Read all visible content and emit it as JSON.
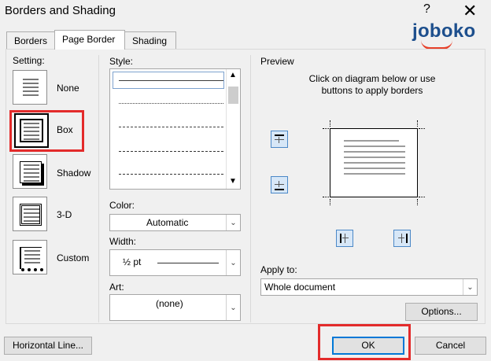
{
  "window": {
    "title": "Borders and Shading",
    "help_icon": "question-mark",
    "close_icon": "close"
  },
  "tabs": [
    {
      "label": "Borders",
      "active": false
    },
    {
      "label": "Page Border",
      "active": true
    },
    {
      "label": "Shading",
      "active": false
    }
  ],
  "logo": {
    "text": "joboko",
    "color": "#1d4f8d",
    "accent": "#e7412a"
  },
  "settings": {
    "label": "Setting:",
    "items": [
      {
        "label": "None",
        "selected": false
      },
      {
        "label": "Box",
        "selected": true
      },
      {
        "label": "Shadow",
        "selected": false
      },
      {
        "label": "3-D",
        "selected": false
      },
      {
        "label": "Custom",
        "selected": false
      }
    ]
  },
  "style": {
    "label": "Style:",
    "selected_index": 0
  },
  "color": {
    "label": "Color:",
    "value": "Automatic"
  },
  "width": {
    "label": "Width:",
    "value": "½ pt"
  },
  "art": {
    "label": "Art:",
    "value": "(none)"
  },
  "preview": {
    "label": "Preview",
    "instructions": "Click on diagram below or use buttons to apply borders"
  },
  "apply_to": {
    "label": "Apply to:",
    "value": "Whole document"
  },
  "buttons": {
    "options": "Options...",
    "horizontal_line": "Horizontal Line...",
    "ok": "OK",
    "cancel": "Cancel"
  },
  "highlight_color": "#e32b2b",
  "focus_color": "#0078d7"
}
